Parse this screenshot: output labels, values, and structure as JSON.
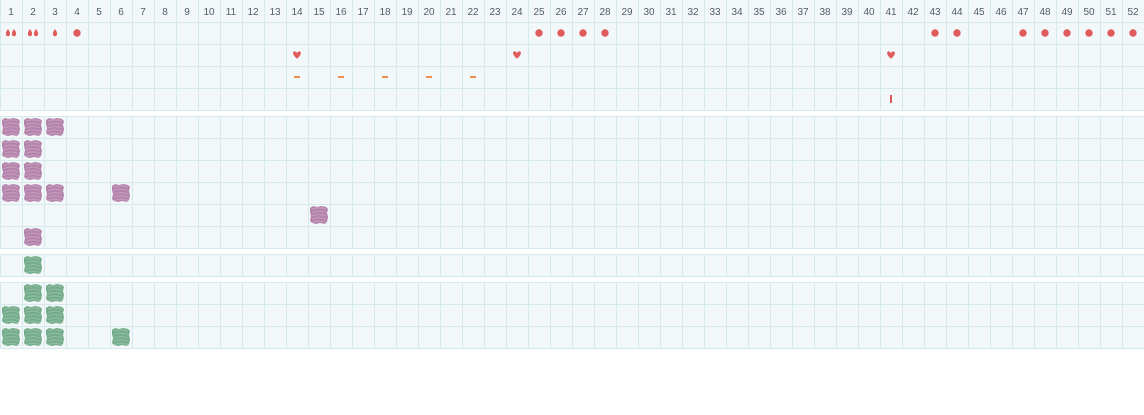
{
  "week_labels": [
    "1",
    "2",
    "3",
    "4",
    "5",
    "6",
    "7",
    "8",
    "9",
    "10",
    "11",
    "12",
    "13",
    "14",
    "15",
    "16",
    "17",
    "18",
    "19",
    "20",
    "21",
    "22",
    "23",
    "24",
    "25",
    "26",
    "27",
    "28",
    "29",
    "30",
    "31",
    "32",
    "33",
    "34",
    "35",
    "36",
    "37",
    "38",
    "39",
    "40",
    "41",
    "42",
    "43",
    "44",
    "45",
    "46",
    "47",
    "48",
    "49",
    "50",
    "51",
    "52"
  ],
  "colors": {
    "grid_bg": "#f2f7f9",
    "grid_line": "#d6eaec",
    "red_marker": "#e05c5c",
    "orange_marker": "#ef8c4e",
    "purple_blob": "#b07aa5",
    "green_blob": "#6aa582"
  },
  "bands": [
    {
      "id": "cycle-band",
      "rows": [
        {
          "markers": [
            {
              "week": 1,
              "type": "drop",
              "count": 2
            },
            {
              "week": 2,
              "type": "drop",
              "count": 2
            },
            {
              "week": 3,
              "type": "drop",
              "count": 1
            },
            {
              "week": 4,
              "type": "dot"
            },
            {
              "week": 25,
              "type": "dot"
            },
            {
              "week": 26,
              "type": "dot"
            },
            {
              "week": 27,
              "type": "dot"
            },
            {
              "week": 28,
              "type": "dot"
            },
            {
              "week": 43,
              "type": "dot"
            },
            {
              "week": 44,
              "type": "dot"
            },
            {
              "week": 47,
              "type": "dot"
            },
            {
              "week": 48,
              "type": "dot"
            },
            {
              "week": 49,
              "type": "dot"
            },
            {
              "week": 50,
              "type": "dot"
            },
            {
              "week": 51,
              "type": "dot"
            },
            {
              "week": 52,
              "type": "dot"
            }
          ]
        },
        {
          "markers": [
            {
              "week": 14,
              "type": "heart"
            },
            {
              "week": 24,
              "type": "heart"
            },
            {
              "week": 41,
              "type": "heart"
            }
          ]
        },
        {
          "markers": [
            {
              "week": 14,
              "type": "dash"
            },
            {
              "week": 16,
              "type": "dash"
            },
            {
              "week": 18,
              "type": "dash"
            },
            {
              "week": 20,
              "type": "dash"
            },
            {
              "week": 22,
              "type": "dash"
            }
          ]
        },
        {
          "markers": [
            {
              "week": 41,
              "type": "tick"
            }
          ]
        }
      ]
    },
    {
      "id": "purple-band",
      "color": "purple",
      "rows": [
        {
          "weeks": [
            1,
            2,
            3
          ]
        },
        {
          "weeks": [
            1,
            2
          ]
        },
        {
          "weeks": [
            1,
            2
          ]
        },
        {
          "weeks": [
            1,
            2,
            3,
            6
          ]
        },
        {
          "weeks": [
            15
          ]
        },
        {
          "weeks": [
            2
          ]
        }
      ]
    },
    {
      "id": "green-band-single",
      "color": "green",
      "rows": [
        {
          "weeks": [
            2
          ]
        }
      ]
    },
    {
      "id": "green-band",
      "color": "green",
      "rows": [
        {
          "weeks": [
            2,
            3
          ]
        },
        {
          "weeks": [
            1,
            2,
            3
          ]
        },
        {
          "weeks": [
            1,
            2,
            3,
            6
          ]
        }
      ]
    }
  ]
}
